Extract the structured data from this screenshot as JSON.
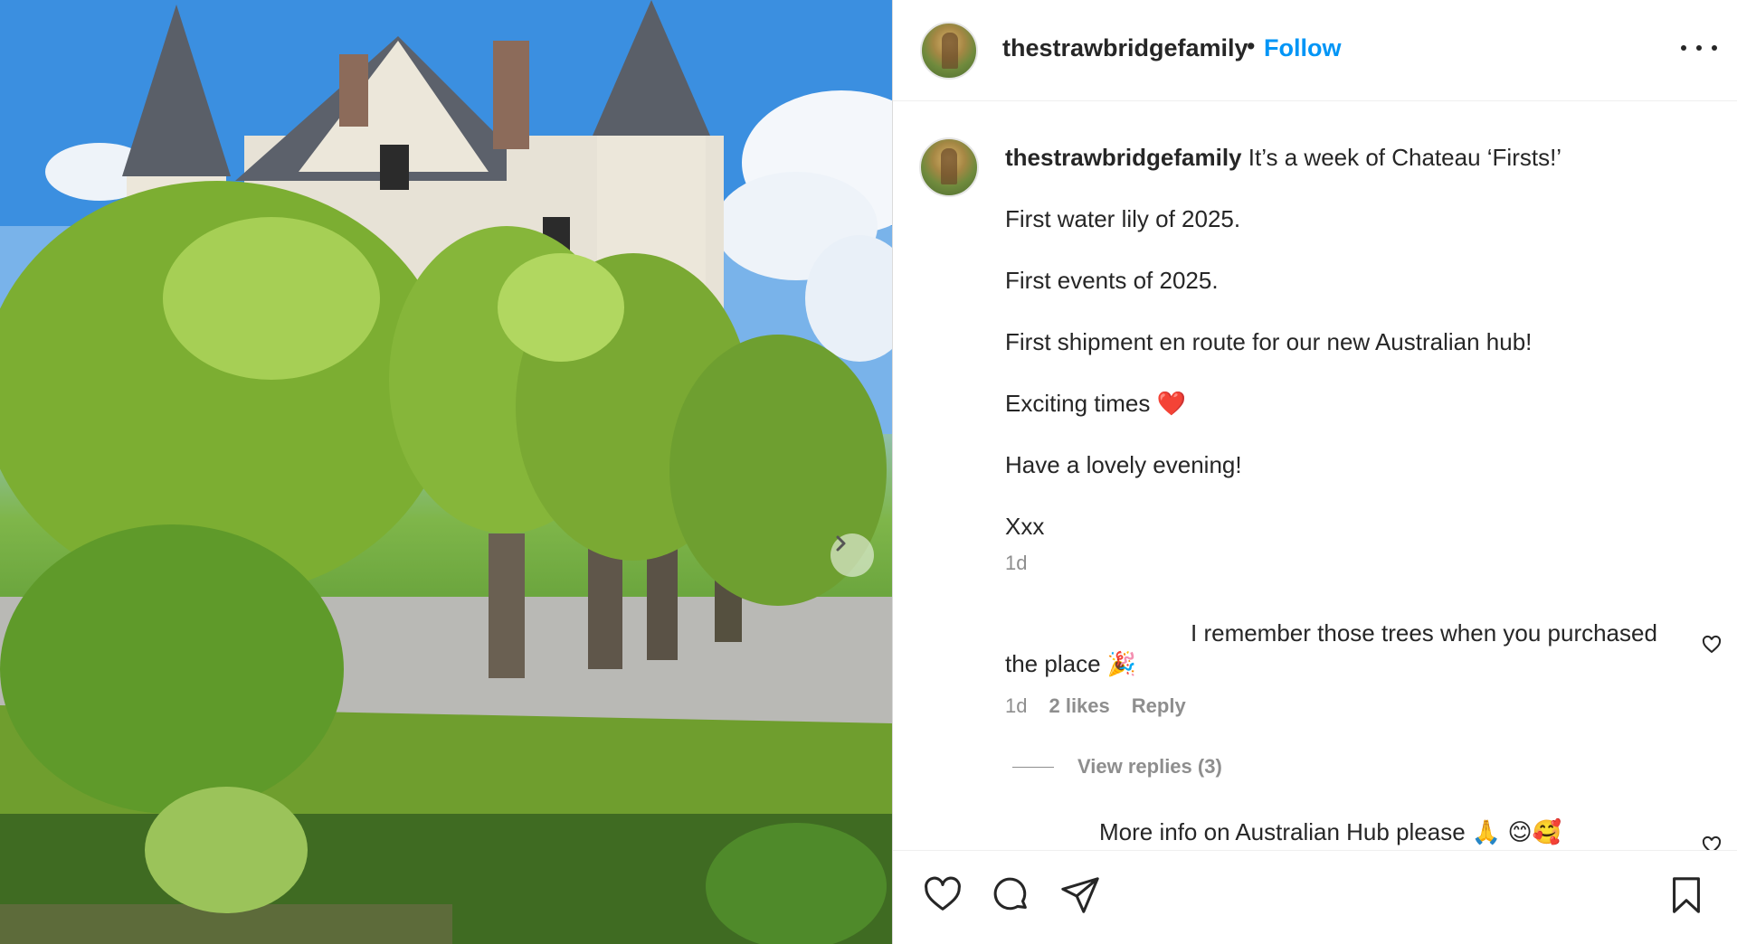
{
  "post": {
    "username": "thestrawbridgefamily",
    "separator": "•",
    "follow_label": "Follow",
    "more_icon": "more-options-icon"
  },
  "caption": {
    "username": "thestrawbridgefamily",
    "lines": [
      "It’s a week of Chateau ‘Firsts!’",
      "First water lily of 2025.",
      "First events of 2025.",
      "First shipment en route for our new Australian hub!",
      "Exciting times ❤️",
      "Have a lovely evening!",
      "Xxx"
    ],
    "time": "1d"
  },
  "comments": [
    {
      "text_line1": "I remember those trees when you purchased",
      "text_line2": "the place 🎉",
      "time": "1d",
      "likes": "2 likes",
      "reply_label": "Reply",
      "view_replies": "View replies (3)"
    },
    {
      "text": "More info on Australian Hub please 🙏 😊🥰"
    }
  ],
  "actions": {
    "like_icon": "heart-icon",
    "comment_icon": "comment-icon",
    "share_icon": "share-icon",
    "save_icon": "bookmark-icon"
  },
  "colors": {
    "link_blue": "#0095f6",
    "text": "#262626",
    "muted": "#8e8e8e"
  }
}
